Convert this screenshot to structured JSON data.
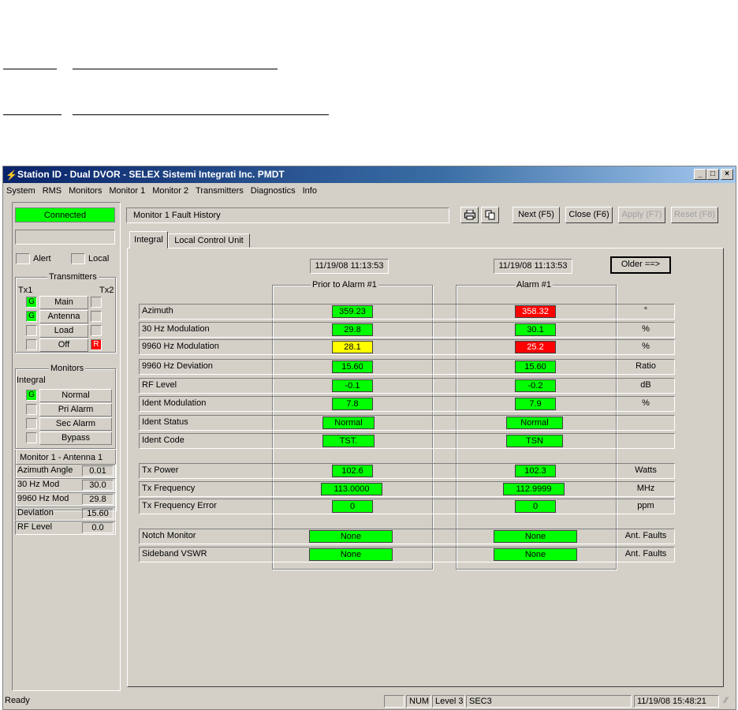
{
  "window": {
    "title": "Station ID - Dual DVOR - SELEX Sistemi Integrati Inc. PMDT",
    "minimize": "_",
    "maximize": "□",
    "close": "×"
  },
  "menu": [
    "System",
    "RMS",
    "Monitors",
    "Monitor 1",
    "Monitor 2",
    "Transmitters",
    "Diagnostics",
    "Info"
  ],
  "left": {
    "connection_status": "Connected",
    "alert": "Alert",
    "local": "Local",
    "transmitters": {
      "title": "Transmitters",
      "tx1": "Tx1",
      "tx2": "Tx2",
      "items": [
        {
          "label": "Main",
          "tx1": "G",
          "tx2": ""
        },
        {
          "label": "Antenna",
          "tx1": "G",
          "tx2": ""
        },
        {
          "label": "Load",
          "tx1": "",
          "tx2": ""
        },
        {
          "label": "Off",
          "tx1": "",
          "tx2": "R"
        }
      ]
    },
    "monitors": {
      "title": "Monitors",
      "mode": "Integral",
      "items": [
        {
          "label": "Normal",
          "state": "G"
        },
        {
          "label": "Pri Alarm",
          "state": ""
        },
        {
          "label": "Sec Alarm",
          "state": ""
        },
        {
          "label": "Bypass",
          "state": ""
        }
      ],
      "subtitle": "Monitor 1 - Antenna 1",
      "readings": [
        {
          "label": "Azimuth Angle",
          "value": "0.01"
        },
        {
          "label": "30 Hz Mod",
          "value": "30.0"
        },
        {
          "label": "9960 Hz Mod",
          "value": "29.8"
        },
        {
          "label": "Deviation",
          "value": "15.60"
        },
        {
          "label": "RF Level",
          "value": "0.0"
        }
      ]
    }
  },
  "panel": {
    "title": "Monitor 1 Fault History",
    "buttons": {
      "print_icon": "printer-icon",
      "copy_icon": "copy-icon",
      "next": "Next (F5)",
      "close": "Close (F6)",
      "apply": "Apply (F7)",
      "reset": "Reset (F8)"
    },
    "tabs": [
      "Integral",
      "Local Control Unit"
    ],
    "older": "Older ==>",
    "col1": {
      "timestamp": "11/19/08 11:13:53",
      "title": "Prior to Alarm #1"
    },
    "col2": {
      "timestamp": "11/19/08 11:13:53",
      "title": "Alarm #1"
    },
    "rows": [
      {
        "label": "Azimuth",
        "v1": "359.23",
        "c1": "green",
        "v2": "358.32",
        "c2": "red",
        "unit": "°"
      },
      {
        "label": "30 Hz Modulation",
        "v1": "29.8",
        "c1": "green",
        "v2": "30.1",
        "c2": "green",
        "unit": "%"
      },
      {
        "label": "9960 Hz Modulation",
        "v1": "28.1",
        "c1": "yellow",
        "v2": "25.2",
        "c2": "red",
        "unit": "%"
      },
      {
        "label": "9960 Hz Deviation",
        "v1": "15.60",
        "c1": "green",
        "v2": "15.60",
        "c2": "green",
        "unit": "Ratio"
      },
      {
        "label": "RF Level",
        "v1": "-0.1",
        "c1": "green",
        "v2": "-0.2",
        "c2": "green",
        "unit": "dB"
      },
      {
        "label": "Ident Modulation",
        "v1": "7.8",
        "c1": "green",
        "v2": "7.9",
        "c2": "green",
        "unit": "%"
      },
      {
        "label": "Ident Status",
        "v1": "Normal",
        "c1": "green",
        "v2": "Normal",
        "c2": "green",
        "unit": ""
      },
      {
        "label": "Ident Code",
        "v1": "TST.",
        "c1": "green",
        "v2": "TSN",
        "c2": "green",
        "unit": ""
      },
      {
        "label": "Tx Power",
        "v1": "102.6",
        "c1": "green",
        "v2": "102.3",
        "c2": "green",
        "unit": "Watts"
      },
      {
        "label": "Tx Frequency",
        "v1": "113.0000",
        "c1": "green",
        "v2": "112.9999",
        "c2": "green",
        "unit": "MHz"
      },
      {
        "label": "Tx Frequency Error",
        "v1": "0",
        "c1": "green",
        "v2": "0",
        "c2": "green",
        "unit": "ppm"
      },
      {
        "label": "Notch Monitor",
        "v1": "None",
        "c1": "green",
        "v2": "None",
        "c2": "green",
        "unit": "Ant. Faults"
      },
      {
        "label": "Sideband VSWR",
        "v1": "None",
        "c1": "green",
        "v2": "None",
        "c2": "green",
        "unit": "Ant. Faults"
      }
    ]
  },
  "status": {
    "ready": "Ready",
    "num": "NUM",
    "level": "Level 3",
    "sec": "SEC3",
    "datetime": "11/19/08 15:48:21"
  },
  "colors": {
    "green": "#00ff00",
    "red": "#ff0000",
    "yellow": "#ffff00",
    "titlebar": "#0a246a"
  }
}
